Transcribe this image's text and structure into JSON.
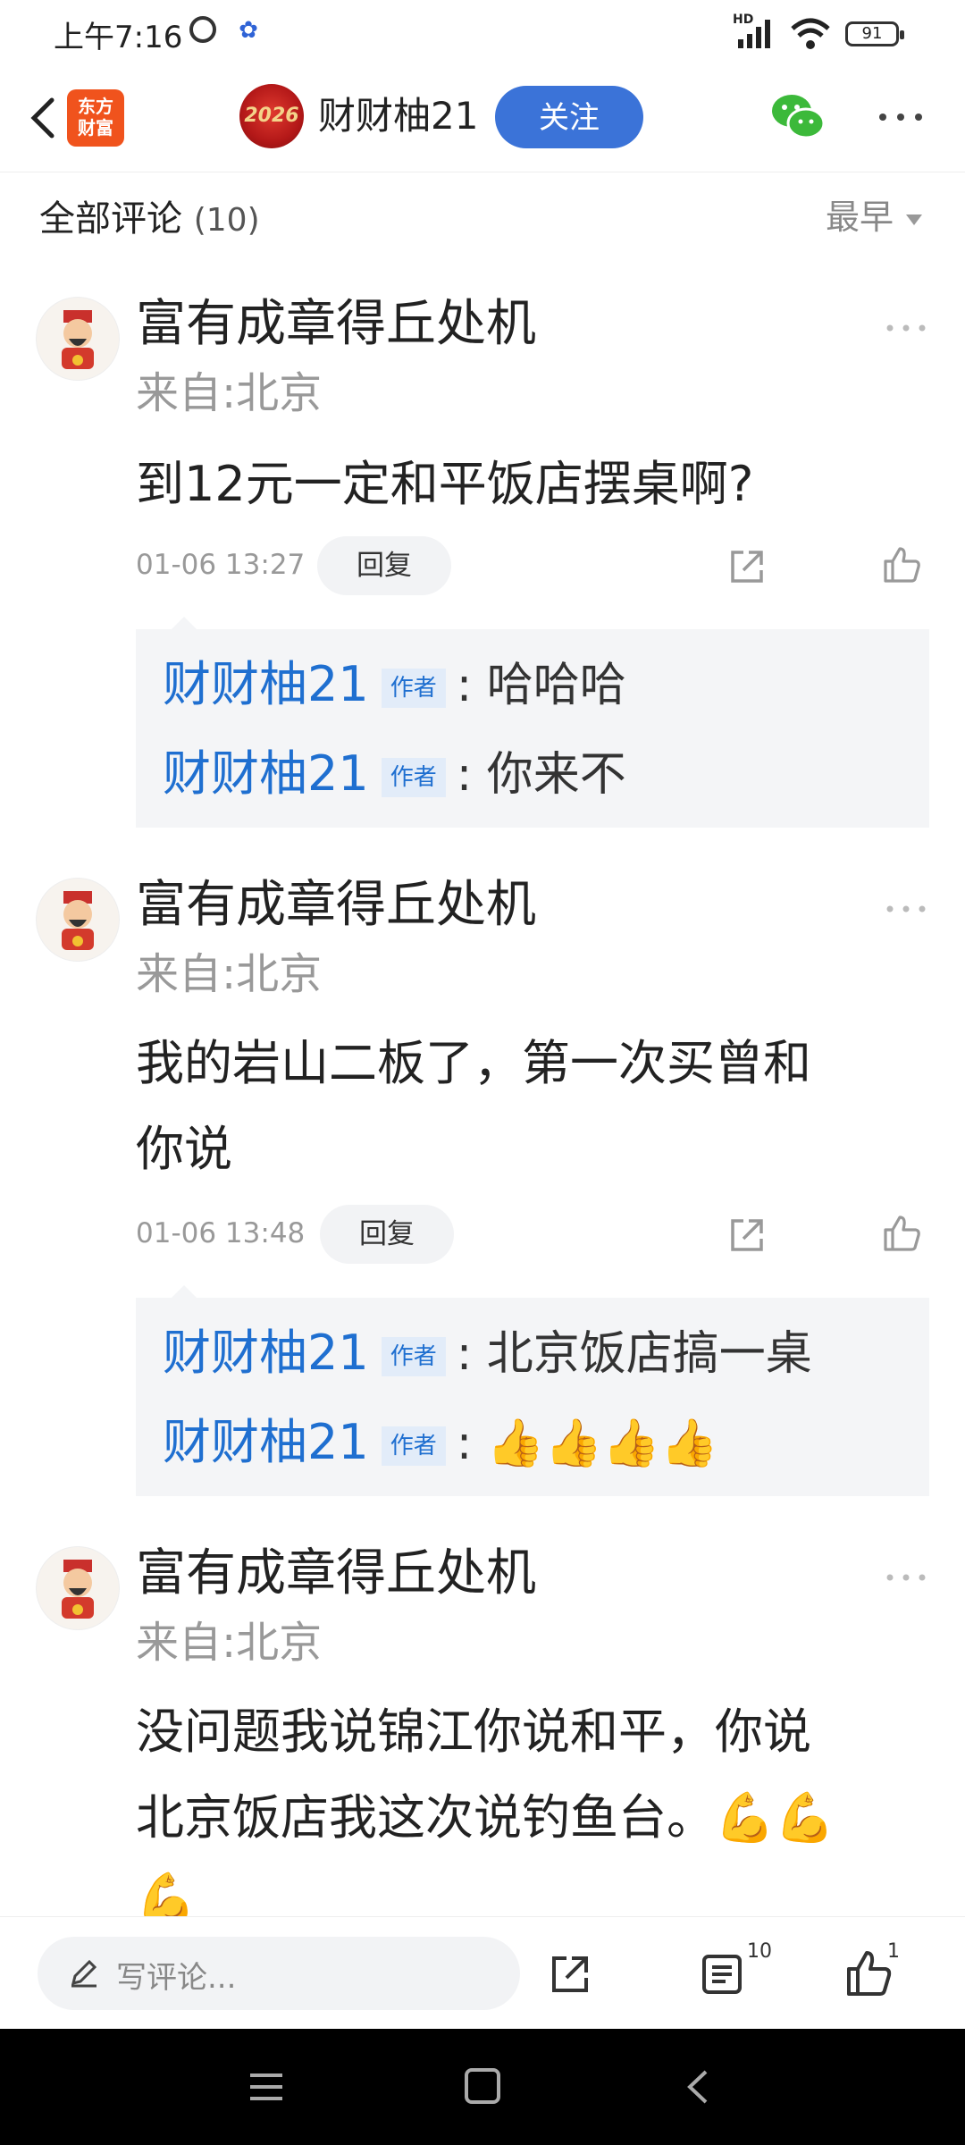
{
  "status": {
    "time": "上午7:16",
    "hd": "HD",
    "battery": "91"
  },
  "header": {
    "app_logo": "东方\n财富",
    "avatar_text": "2026",
    "author_name": "财财柚21",
    "follow_label": "关注"
  },
  "comments_header": {
    "title": "全部评论",
    "count": "(10)",
    "sort_label": "最早"
  },
  "comments": [
    {
      "user": "富有成章得丘处机",
      "location": "来自:北京",
      "body": "到12元一定和平饭店摆桌啊?",
      "time": "01-06 13:27",
      "reply_label": "回复",
      "replies": [
        {
          "author": "财财柚21",
          "badge": "作者",
          "text": ": 哈哈哈"
        },
        {
          "author": "财财柚21",
          "badge": "作者",
          "text": ": 你来不"
        }
      ]
    },
    {
      "user": "富有成章得丘处机",
      "location": "来自:北京",
      "body_line1": "我的岩山二板了，第一次买曾和",
      "body_line2": "你说",
      "time": "01-06 13:48",
      "reply_label": "回复",
      "replies": [
        {
          "author": "财财柚21",
          "badge": "作者",
          "text": ": 北京饭店搞一桌"
        },
        {
          "author": "财财柚21",
          "badge": "作者",
          "text": ":",
          "emoji": "👍👍👍👍"
        }
      ]
    },
    {
      "user": "富有成章得丘处机",
      "location": "来自:北京",
      "body_line1": "没问题我说锦江你说和平，你说",
      "body_line2": "北京饭店我这次说钓鱼台。💪💪",
      "body_line3": "💪"
    }
  ],
  "bottom_bar": {
    "write_placeholder": "写评论...",
    "list_count": "10",
    "like_count": "1"
  },
  "icons": [
    "back-icon",
    "alarm-icon",
    "baidu-icon",
    "signal-icon",
    "wifi-icon",
    "battery-icon",
    "wechat-icon",
    "more-icon",
    "share-icon",
    "like-icon",
    "pen-icon",
    "list-icon",
    "menu-icon",
    "home-icon",
    "nav-back-icon"
  ],
  "colors": {
    "accent_blue": "#3b73d8",
    "author_link": "#1f6fd0",
    "reply_bg": "#f4f5f7",
    "logo_orange": "#f0531d"
  }
}
